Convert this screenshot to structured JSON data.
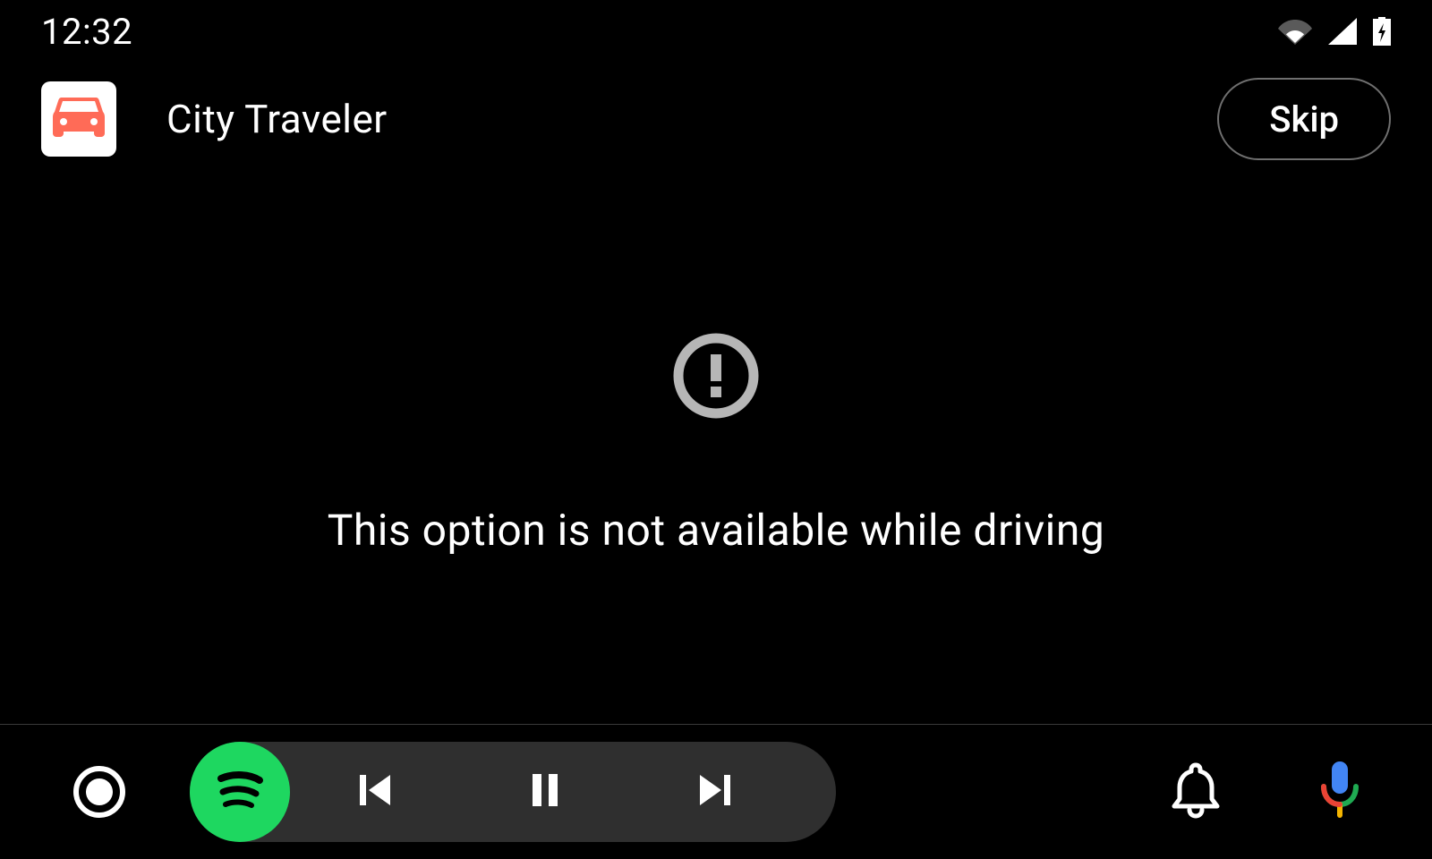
{
  "status": {
    "time": "12:32"
  },
  "header": {
    "app_name": "City Traveler",
    "skip_label": "Skip"
  },
  "main": {
    "message": "This option is not available while driving"
  }
}
